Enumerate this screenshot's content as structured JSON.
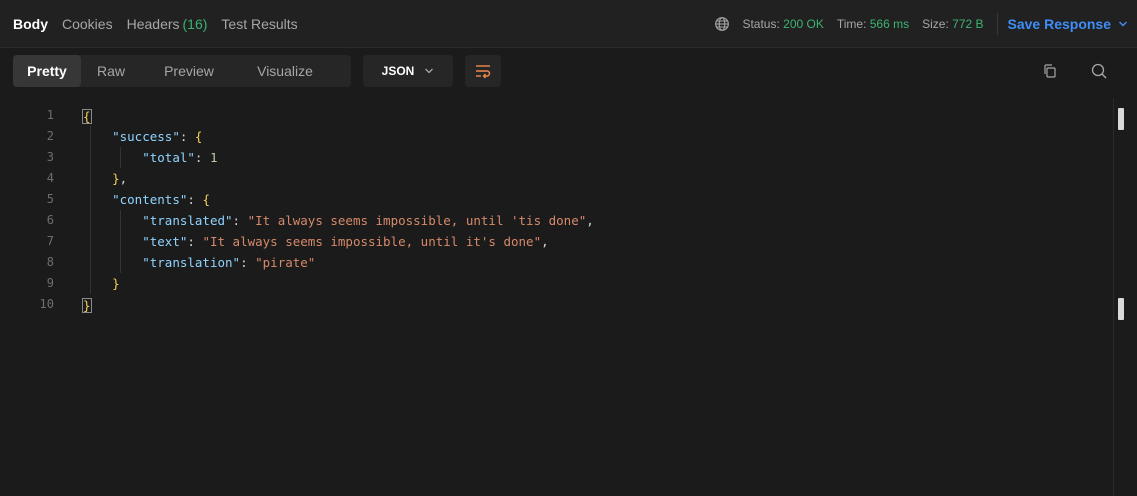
{
  "response_tabs": [
    {
      "label": "Body",
      "active": true
    },
    {
      "label": "Cookies",
      "active": false
    },
    {
      "label": "Headers",
      "count": "(16)",
      "active": false
    },
    {
      "label": "Test Results",
      "active": false
    }
  ],
  "status": {
    "status_label": "Status:",
    "status_value": "200 OK",
    "time_label": "Time:",
    "time_value": "566 ms",
    "size_label": "Size:",
    "size_value": "772 B"
  },
  "save_response": "Save Response",
  "view_modes": [
    "Pretty",
    "Raw",
    "Preview",
    "Visualize"
  ],
  "active_view": "Pretty",
  "format": "JSON",
  "colors": {
    "accent": "#3f8ef7",
    "success": "#3cb371",
    "key": "#8fd4ff",
    "string": "#d7896b",
    "number": "#b5cea8"
  },
  "code_lines": [
    {
      "n": "1",
      "tokens": [
        {
          "t": "{",
          "c": "bracket-box"
        }
      ]
    },
    {
      "n": "2",
      "tokens": [
        {
          "t": "    ",
          "c": "punc"
        },
        {
          "t": "\"success\"",
          "c": "key"
        },
        {
          "t": ": ",
          "c": "punc"
        },
        {
          "t": "{",
          "c": "brace"
        }
      ]
    },
    {
      "n": "3",
      "tokens": [
        {
          "t": "        ",
          "c": "punc"
        },
        {
          "t": "\"total\"",
          "c": "key"
        },
        {
          "t": ": ",
          "c": "punc"
        },
        {
          "t": "1",
          "c": "num"
        }
      ]
    },
    {
      "n": "4",
      "tokens": [
        {
          "t": "    ",
          "c": "punc"
        },
        {
          "t": "}",
          "c": "brace"
        },
        {
          "t": ",",
          "c": "punc"
        }
      ]
    },
    {
      "n": "5",
      "tokens": [
        {
          "t": "    ",
          "c": "punc"
        },
        {
          "t": "\"contents\"",
          "c": "key"
        },
        {
          "t": ": ",
          "c": "punc"
        },
        {
          "t": "{",
          "c": "brace"
        }
      ]
    },
    {
      "n": "6",
      "tokens": [
        {
          "t": "        ",
          "c": "punc"
        },
        {
          "t": "\"translated\"",
          "c": "key"
        },
        {
          "t": ": ",
          "c": "punc"
        },
        {
          "t": "\"It always seems impossible, until 'tis done\"",
          "c": "str"
        },
        {
          "t": ",",
          "c": "punc"
        }
      ]
    },
    {
      "n": "7",
      "tokens": [
        {
          "t": "        ",
          "c": "punc"
        },
        {
          "t": "\"text\"",
          "c": "key"
        },
        {
          "t": ": ",
          "c": "punc"
        },
        {
          "t": "\"It always seems impossible, until it's done\"",
          "c": "str"
        },
        {
          "t": ",",
          "c": "punc"
        }
      ]
    },
    {
      "n": "8",
      "tokens": [
        {
          "t": "        ",
          "c": "punc"
        },
        {
          "t": "\"translation\"",
          "c": "key"
        },
        {
          "t": ": ",
          "c": "punc"
        },
        {
          "t": "\"pirate\"",
          "c": "str"
        }
      ]
    },
    {
      "n": "9",
      "tokens": [
        {
          "t": "    ",
          "c": "punc"
        },
        {
          "t": "}",
          "c": "brace"
        }
      ]
    },
    {
      "n": "10",
      "tokens": [
        {
          "t": "}",
          "c": "bracket-box"
        }
      ]
    }
  ]
}
